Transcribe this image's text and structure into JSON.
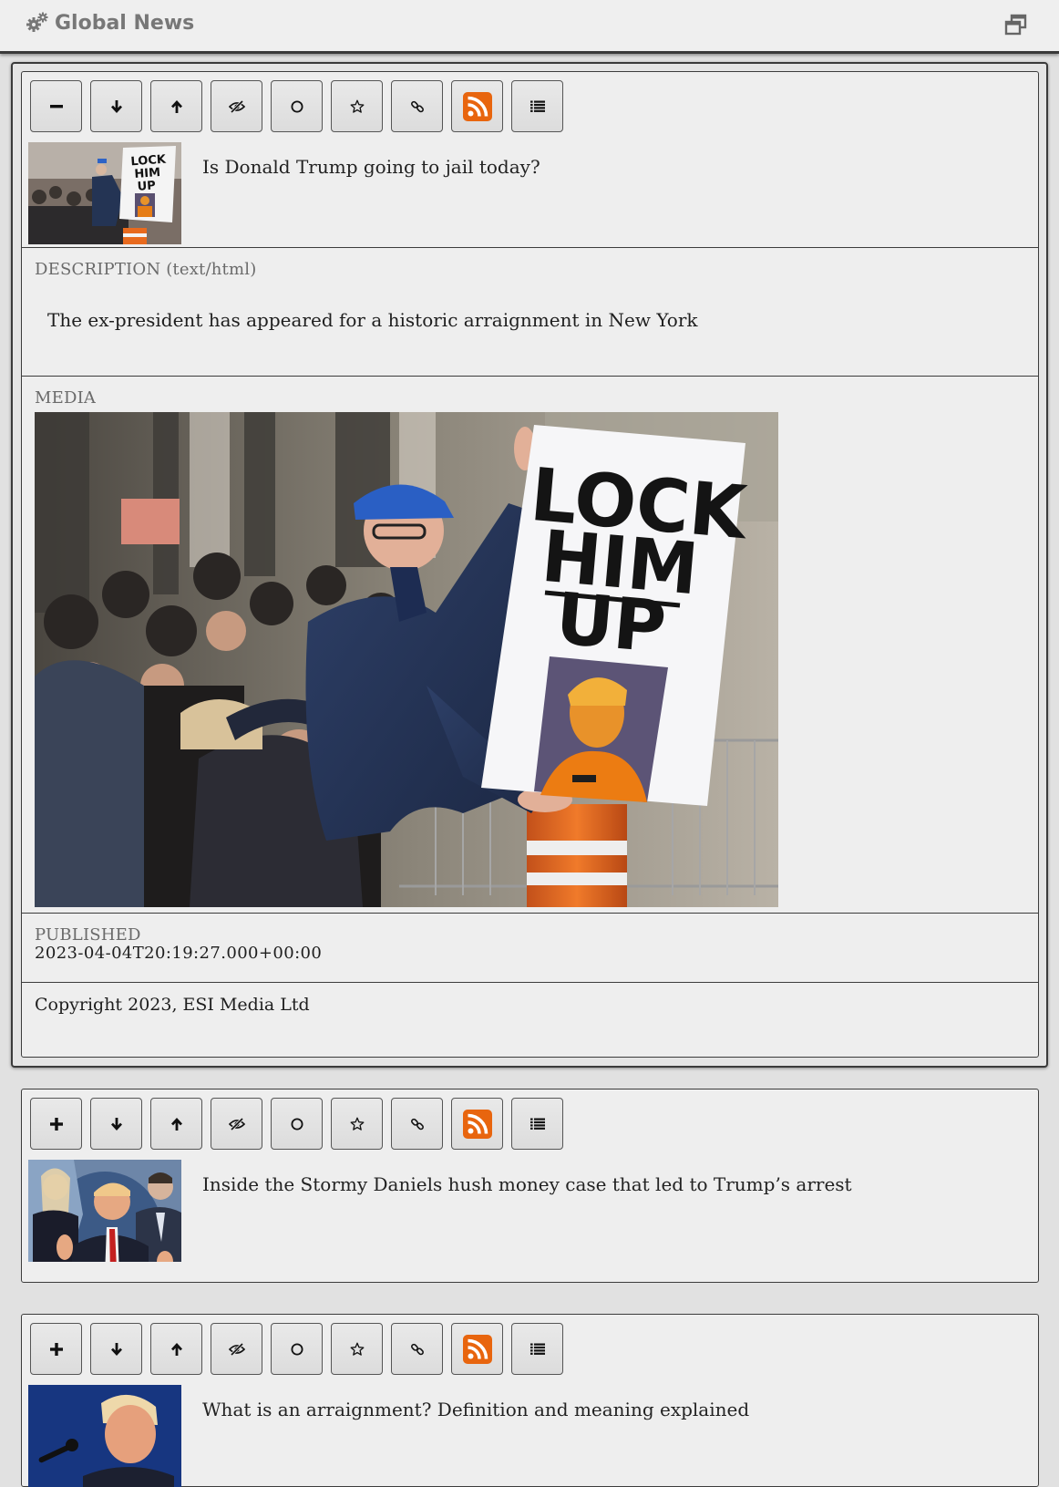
{
  "app": {
    "title": "Global News"
  },
  "icons": {
    "app": "gears-icon",
    "restore": "window-restore-icon",
    "collapse": "minus-icon",
    "expand": "plus-icon",
    "move_down": "arrow-down-icon",
    "move_up": "arrow-up-icon",
    "hide": "eye-slash-icon",
    "read": "circle-icon",
    "favorite": "star-icon",
    "link": "link-icon",
    "rss": "rss-icon",
    "list": "list-icon"
  },
  "colors": {
    "rss_orange": "#e8650e",
    "background": "#e1e1e1",
    "card": "#eeeeee",
    "label": "#6a6a6a"
  },
  "articles": [
    {
      "title": "Is Donald Trump going to jail today?",
      "expanded": true,
      "description_label": "DESCRIPTION (text/html)",
      "description": "The ex-president has appeared for a historic arraignment in New York",
      "media_label": "MEDIA",
      "media_sign_text": "LOCK HIM UP",
      "published_label": "PUBLISHED",
      "published": "2023-04-04T20:19:27.000+00:00",
      "copyright": "Copyright 2023, ESI Media Ltd"
    },
    {
      "title": "Inside the Stormy Daniels hush money case that led to Trump’s arrest",
      "expanded": false
    },
    {
      "title": "What is an arraignment? Definition and meaning explained",
      "expanded": false
    }
  ]
}
